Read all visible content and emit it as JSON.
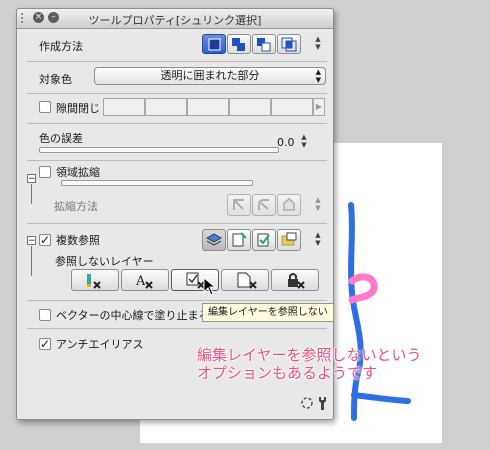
{
  "window": {
    "title": "ツールプロパティ[シュリンク選択]"
  },
  "creation_method": {
    "label": "作成方法"
  },
  "target_color": {
    "label": "対象色",
    "value": "透明に囲まれた部分"
  },
  "gap_close": {
    "label": "隙間閉じ",
    "checked": false
  },
  "color_tolerance": {
    "label": "色の誤差",
    "value": "0.0"
  },
  "area_expand": {
    "label": "領域拡縮",
    "checked": false,
    "method_label": "拡縮方法"
  },
  "multi_ref": {
    "label": "複数参照",
    "checked": true,
    "not_ref_label": "参照しないレイヤー"
  },
  "vector_center": {
    "label": "ベクターの中心線で塗り止まる",
    "checked": false
  },
  "antialias": {
    "label": "アンチエイリアス",
    "checked": true
  },
  "tooltip": {
    "text": "編集レイヤーを参照しない"
  },
  "annotation": {
    "line1": "編集レイヤーを参照しないという",
    "line2": "オプションもあるようです",
    "color": "#f0508a"
  }
}
